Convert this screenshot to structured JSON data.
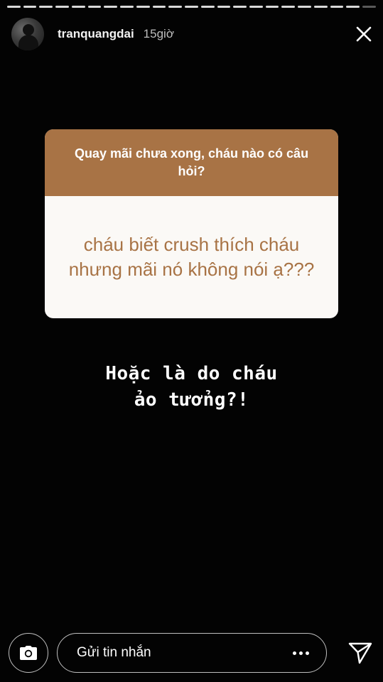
{
  "story": {
    "progress": {
      "segments_total": 23,
      "segments_viewed": 22
    },
    "header": {
      "username": "tranquangdai",
      "time": "15giờ",
      "avatar_icon": "avatar",
      "close_icon": "close-icon"
    },
    "question_card": {
      "question": "Quay mãi chưa xong, cháu nào có câu hỏi?",
      "answer": "cháu biết crush thích cháu nhưng mãi nó không nói ạ???",
      "header_color": "#a87345",
      "answer_color": "#a87345"
    },
    "caption": {
      "line1": "Hoặc là do cháu",
      "line2": "ảo tưởng?!"
    },
    "bottom_bar": {
      "camera_icon": "camera-icon",
      "message_placeholder": "Gửi tin nhắn",
      "more_icon": "more-icon",
      "send_icon": "send-icon"
    }
  }
}
